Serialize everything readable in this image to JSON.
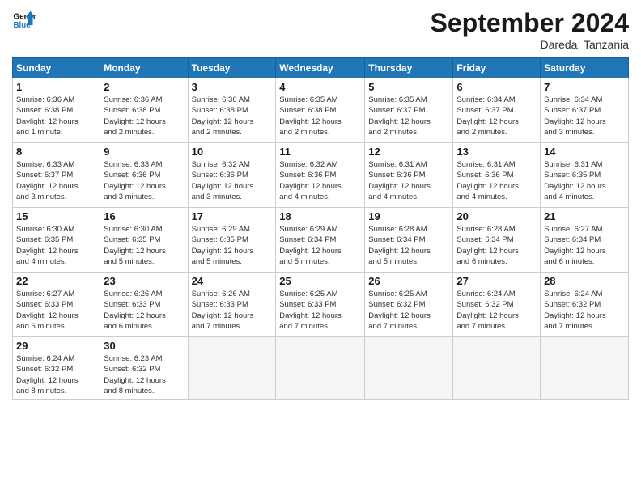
{
  "logo": {
    "line1": "General",
    "line2": "Blue"
  },
  "title": "September 2024",
  "location": "Dareda, Tanzania",
  "days_of_week": [
    "Sunday",
    "Monday",
    "Tuesday",
    "Wednesday",
    "Thursday",
    "Friday",
    "Saturday"
  ],
  "weeks": [
    [
      {
        "day": "1",
        "info": "Sunrise: 6:36 AM\nSunset: 6:38 PM\nDaylight: 12 hours\nand 1 minute."
      },
      {
        "day": "2",
        "info": "Sunrise: 6:36 AM\nSunset: 6:38 PM\nDaylight: 12 hours\nand 2 minutes."
      },
      {
        "day": "3",
        "info": "Sunrise: 6:36 AM\nSunset: 6:38 PM\nDaylight: 12 hours\nand 2 minutes."
      },
      {
        "day": "4",
        "info": "Sunrise: 6:35 AM\nSunset: 6:38 PM\nDaylight: 12 hours\nand 2 minutes."
      },
      {
        "day": "5",
        "info": "Sunrise: 6:35 AM\nSunset: 6:37 PM\nDaylight: 12 hours\nand 2 minutes."
      },
      {
        "day": "6",
        "info": "Sunrise: 6:34 AM\nSunset: 6:37 PM\nDaylight: 12 hours\nand 2 minutes."
      },
      {
        "day": "7",
        "info": "Sunrise: 6:34 AM\nSunset: 6:37 PM\nDaylight: 12 hours\nand 3 minutes."
      }
    ],
    [
      {
        "day": "8",
        "info": "Sunrise: 6:33 AM\nSunset: 6:37 PM\nDaylight: 12 hours\nand 3 minutes."
      },
      {
        "day": "9",
        "info": "Sunrise: 6:33 AM\nSunset: 6:36 PM\nDaylight: 12 hours\nand 3 minutes."
      },
      {
        "day": "10",
        "info": "Sunrise: 6:32 AM\nSunset: 6:36 PM\nDaylight: 12 hours\nand 3 minutes."
      },
      {
        "day": "11",
        "info": "Sunrise: 6:32 AM\nSunset: 6:36 PM\nDaylight: 12 hours\nand 4 minutes."
      },
      {
        "day": "12",
        "info": "Sunrise: 6:31 AM\nSunset: 6:36 PM\nDaylight: 12 hours\nand 4 minutes."
      },
      {
        "day": "13",
        "info": "Sunrise: 6:31 AM\nSunset: 6:36 PM\nDaylight: 12 hours\nand 4 minutes."
      },
      {
        "day": "14",
        "info": "Sunrise: 6:31 AM\nSunset: 6:35 PM\nDaylight: 12 hours\nand 4 minutes."
      }
    ],
    [
      {
        "day": "15",
        "info": "Sunrise: 6:30 AM\nSunset: 6:35 PM\nDaylight: 12 hours\nand 4 minutes."
      },
      {
        "day": "16",
        "info": "Sunrise: 6:30 AM\nSunset: 6:35 PM\nDaylight: 12 hours\nand 5 minutes."
      },
      {
        "day": "17",
        "info": "Sunrise: 6:29 AM\nSunset: 6:35 PM\nDaylight: 12 hours\nand 5 minutes."
      },
      {
        "day": "18",
        "info": "Sunrise: 6:29 AM\nSunset: 6:34 PM\nDaylight: 12 hours\nand 5 minutes."
      },
      {
        "day": "19",
        "info": "Sunrise: 6:28 AM\nSunset: 6:34 PM\nDaylight: 12 hours\nand 5 minutes."
      },
      {
        "day": "20",
        "info": "Sunrise: 6:28 AM\nSunset: 6:34 PM\nDaylight: 12 hours\nand 6 minutes."
      },
      {
        "day": "21",
        "info": "Sunrise: 6:27 AM\nSunset: 6:34 PM\nDaylight: 12 hours\nand 6 minutes."
      }
    ],
    [
      {
        "day": "22",
        "info": "Sunrise: 6:27 AM\nSunset: 6:33 PM\nDaylight: 12 hours\nand 6 minutes."
      },
      {
        "day": "23",
        "info": "Sunrise: 6:26 AM\nSunset: 6:33 PM\nDaylight: 12 hours\nand 6 minutes."
      },
      {
        "day": "24",
        "info": "Sunrise: 6:26 AM\nSunset: 6:33 PM\nDaylight: 12 hours\nand 7 minutes."
      },
      {
        "day": "25",
        "info": "Sunrise: 6:25 AM\nSunset: 6:33 PM\nDaylight: 12 hours\nand 7 minutes."
      },
      {
        "day": "26",
        "info": "Sunrise: 6:25 AM\nSunset: 6:32 PM\nDaylight: 12 hours\nand 7 minutes."
      },
      {
        "day": "27",
        "info": "Sunrise: 6:24 AM\nSunset: 6:32 PM\nDaylight: 12 hours\nand 7 minutes."
      },
      {
        "day": "28",
        "info": "Sunrise: 6:24 AM\nSunset: 6:32 PM\nDaylight: 12 hours\nand 7 minutes."
      }
    ],
    [
      {
        "day": "29",
        "info": "Sunrise: 6:24 AM\nSunset: 6:32 PM\nDaylight: 12 hours\nand 8 minutes."
      },
      {
        "day": "30",
        "info": "Sunrise: 6:23 AM\nSunset: 6:32 PM\nDaylight: 12 hours\nand 8 minutes."
      },
      {
        "day": "",
        "info": ""
      },
      {
        "day": "",
        "info": ""
      },
      {
        "day": "",
        "info": ""
      },
      {
        "day": "",
        "info": ""
      },
      {
        "day": "",
        "info": ""
      }
    ]
  ]
}
